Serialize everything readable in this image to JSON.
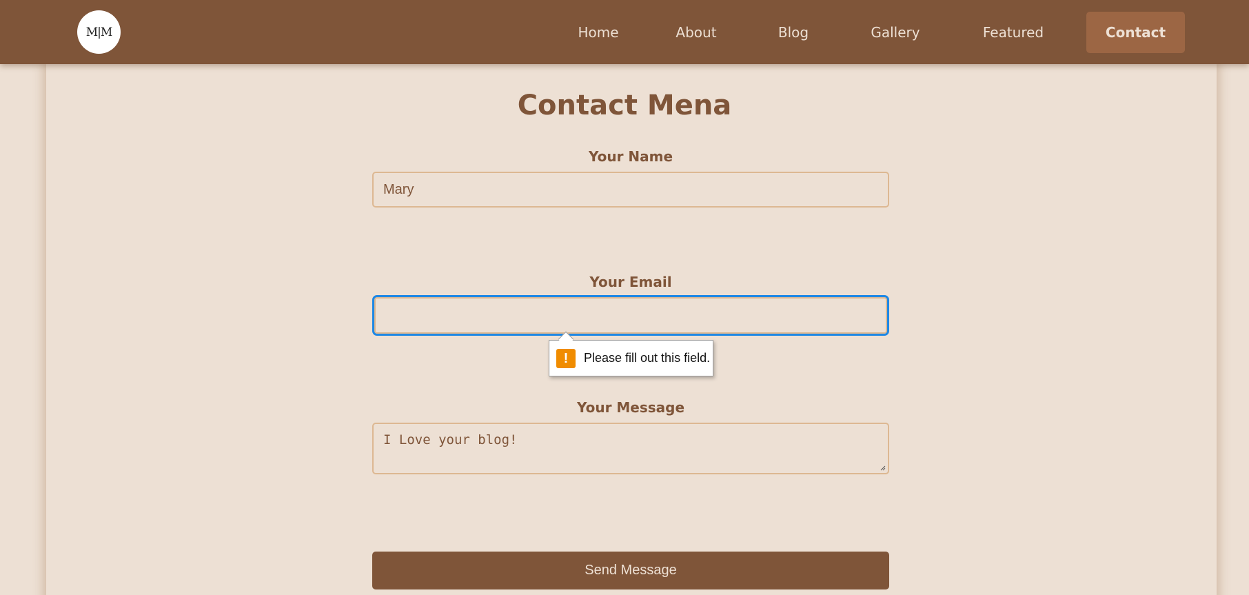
{
  "header": {
    "logo_text": "M|M",
    "nav": [
      {
        "label": "Home"
      },
      {
        "label": "About"
      },
      {
        "label": "Blog"
      },
      {
        "label": "Gallery"
      },
      {
        "label": "Featured"
      },
      {
        "label": "Contact",
        "active": true
      }
    ]
  },
  "page": {
    "title": "Contact Mena"
  },
  "form": {
    "name_label": "Your Name",
    "name_value": "Mary",
    "email_label": "Your Email",
    "email_value": "",
    "message_label": "Your Message",
    "message_value": "I Love your blog!",
    "submit_label": "Send Message"
  },
  "validation_tooltip": {
    "icon": "warning-icon",
    "glyph": "!",
    "text": "Please fill out this field."
  },
  "colors": {
    "background": "#ede0d4",
    "navbar": "#7f5539",
    "active_nav": "#9c6644",
    "border": "#ddb892",
    "focus": "#1e88e5",
    "warning": "#f08c00"
  }
}
